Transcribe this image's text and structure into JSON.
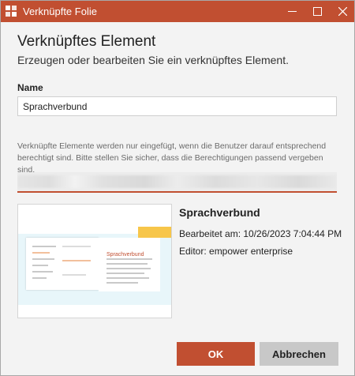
{
  "window": {
    "title": "Verknüpfte Folie",
    "accent_color": "#c14f31",
    "icons": [
      "app-icon",
      "minimize-icon",
      "maximize-icon",
      "close-icon"
    ]
  },
  "dialog": {
    "heading": "Verknüpftes Element",
    "subheading": "Erzeugen oder bearbeiten Sie ein verknüpftes Element.",
    "name_label": "Name",
    "name_value": "Sprachverbund",
    "hint": "Verknüpfte Elemente werden nur eingefügt, wenn die Benutzer darauf entsprechend berechtigt sind. Bitte stellen Sie sicher, dass die Berechtigungen passend vergeben sind.",
    "preview": {
      "title": "Sprachverbund",
      "edited": "Bearbeitet am: 10/26/2023 7:04:44 PM",
      "editor": "Editor: empower enterprise",
      "thumbnail_title": "Sprachverbund"
    },
    "buttons": {
      "ok": "OK",
      "cancel": "Abbrechen"
    }
  }
}
